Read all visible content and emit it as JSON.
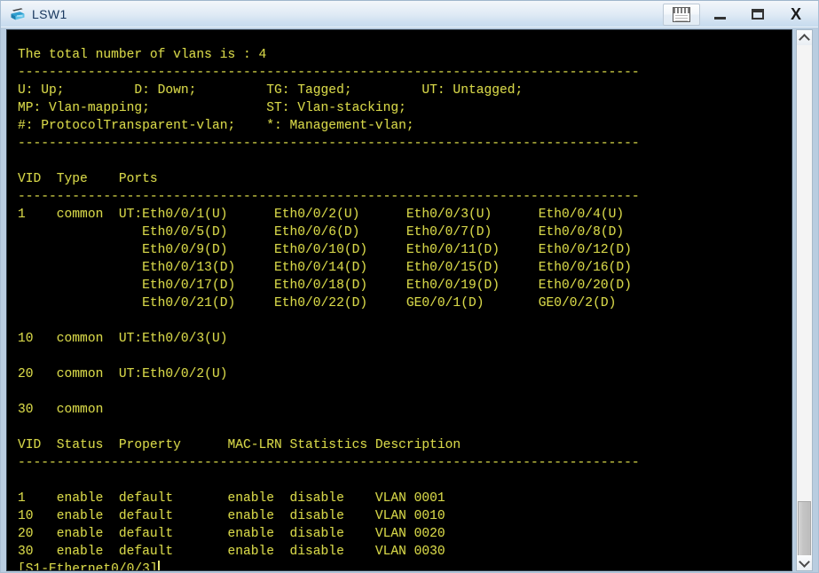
{
  "window": {
    "title": "LSW1",
    "icon": "switch-icon",
    "buttons": {
      "report": "report-icon",
      "minimize": "minimize-icon",
      "maximize": "maximize-icon",
      "close": "X"
    }
  },
  "colors": {
    "terminal_background": "#000000",
    "terminal_foreground": "#d6d64a",
    "titlebar_text": "#17365d"
  },
  "terminal": {
    "prompt": "[S1-Ethernet0/0/3]",
    "lines": [
      "The total number of vlans is : 4",
      "--------------------------------------------------------------------------------",
      "U: Up;         D: Down;         TG: Tagged;         UT: Untagged;",
      "MP: Vlan-mapping;               ST: Vlan-stacking;",
      "#: ProtocolTransparent-vlan;    *: Management-vlan;",
      "--------------------------------------------------------------------------------",
      "",
      "VID  Type    Ports",
      "--------------------------------------------------------------------------------",
      "1    common  UT:Eth0/0/1(U)      Eth0/0/2(U)      Eth0/0/3(U)      Eth0/0/4(U)",
      "                Eth0/0/5(D)      Eth0/0/6(D)      Eth0/0/7(D)      Eth0/0/8(D)",
      "                Eth0/0/9(D)      Eth0/0/10(D)     Eth0/0/11(D)     Eth0/0/12(D)",
      "                Eth0/0/13(D)     Eth0/0/14(D)     Eth0/0/15(D)     Eth0/0/16(D)",
      "                Eth0/0/17(D)     Eth0/0/18(D)     Eth0/0/19(D)     Eth0/0/20(D)",
      "                Eth0/0/21(D)     Eth0/0/22(D)     GE0/0/1(D)       GE0/0/2(D)",
      "",
      "10   common  UT:Eth0/0/3(U)",
      "",
      "20   common  UT:Eth0/0/2(U)",
      "",
      "30   common",
      "",
      "VID  Status  Property      MAC-LRN Statistics Description",
      "--------------------------------------------------------------------------------",
      "",
      "1    enable  default       enable  disable    VLAN 0001",
      "10   enable  default       enable  disable    VLAN 0010",
      "20   enable  default       enable  disable    VLAN 0020",
      "30   enable  default       enable  disable    VLAN 0030"
    ],
    "vlan_summary": {
      "total_vlans": 4,
      "legend": {
        "U": "Up",
        "D": "Down",
        "TG": "Tagged",
        "UT": "Untagged",
        "MP": "Vlan-mapping",
        "ST": "Vlan-stacking",
        "#": "ProtocolTransparent-vlan",
        "*": "Management-vlan"
      },
      "ports_table": {
        "headers": [
          "VID",
          "Type",
          "Ports"
        ],
        "rows": [
          {
            "vid": "1",
            "type": "common",
            "ports": [
              "UT:Eth0/0/1(U)",
              "Eth0/0/2(U)",
              "Eth0/0/3(U)",
              "Eth0/0/4(U)",
              "Eth0/0/5(D)",
              "Eth0/0/6(D)",
              "Eth0/0/7(D)",
              "Eth0/0/8(D)",
              "Eth0/0/9(D)",
              "Eth0/0/10(D)",
              "Eth0/0/11(D)",
              "Eth0/0/12(D)",
              "Eth0/0/13(D)",
              "Eth0/0/14(D)",
              "Eth0/0/15(D)",
              "Eth0/0/16(D)",
              "Eth0/0/17(D)",
              "Eth0/0/18(D)",
              "Eth0/0/19(D)",
              "Eth0/0/20(D)",
              "Eth0/0/21(D)",
              "Eth0/0/22(D)",
              "GE0/0/1(D)",
              "GE0/0/2(D)"
            ]
          },
          {
            "vid": "10",
            "type": "common",
            "ports": [
              "UT:Eth0/0/3(U)"
            ]
          },
          {
            "vid": "20",
            "type": "common",
            "ports": [
              "UT:Eth0/0/2(U)"
            ]
          },
          {
            "vid": "30",
            "type": "common",
            "ports": []
          }
        ]
      },
      "status_table": {
        "headers": [
          "VID",
          "Status",
          "Property",
          "MAC-LRN",
          "Statistics",
          "Description"
        ],
        "rows": [
          [
            "1",
            "enable",
            "default",
            "enable",
            "disable",
            "VLAN 0001"
          ],
          [
            "10",
            "enable",
            "default",
            "enable",
            "disable",
            "VLAN 0010"
          ],
          [
            "20",
            "enable",
            "default",
            "enable",
            "disable",
            "VLAN 0020"
          ],
          [
            "30",
            "enable",
            "default",
            "enable",
            "disable",
            "VLAN 0030"
          ]
        ]
      }
    }
  },
  "scrollbar": {
    "up_arrow": "chevron-up-icon",
    "down_arrow": "chevron-down-icon"
  }
}
